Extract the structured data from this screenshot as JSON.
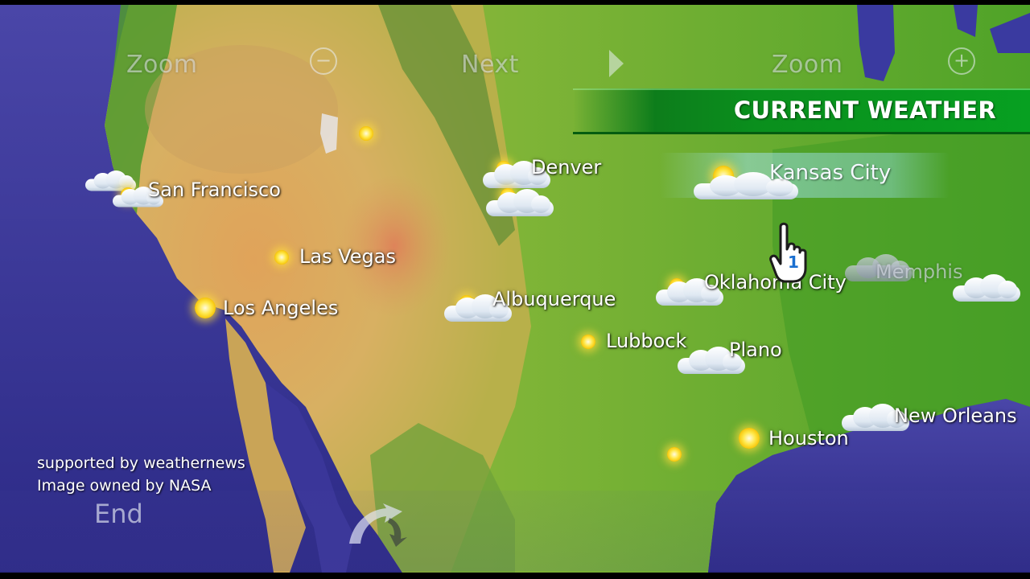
{
  "controls": {
    "zoom_out_label": "Zoom",
    "zoom_out_symbol": "−",
    "next_label": "Next",
    "zoom_in_label": "Zoom",
    "zoom_in_symbol": "+"
  },
  "banner": {
    "title": "CURRENT WEATHER"
  },
  "cities": [
    {
      "name": "San Francisco",
      "weather": "cloudy-sun"
    },
    {
      "name": "Denver",
      "weather": "cloudy-sun"
    },
    {
      "name": "Kansas City",
      "weather": "cloudy-sun"
    },
    {
      "name": "Las Vegas",
      "weather": "sunny"
    },
    {
      "name": "Los Angeles",
      "weather": "sunny"
    },
    {
      "name": "Albuquerque",
      "weather": "cloudy-sun"
    },
    {
      "name": "Oklahoma City",
      "weather": "cloudy-sun"
    },
    {
      "name": "Memphis",
      "weather": "cloudy"
    },
    {
      "name": "Lubbock",
      "weather": "sunny"
    },
    {
      "name": "Plano",
      "weather": "cloudy"
    },
    {
      "name": "New Orleans",
      "weather": "cloudy"
    },
    {
      "name": "Houston",
      "weather": "sunny"
    }
  ],
  "selected_city": "Kansas City",
  "credits": {
    "line1": "supported by weathernews",
    "line2": "Image owned by NASA"
  },
  "end_label": "End",
  "pointer": {
    "player_number": "1",
    "icon": "hand-pointer-icon"
  },
  "colors": {
    "ocean": "#3b3494",
    "banner_green": "#0a8f1d",
    "land_green": "#5fae2a",
    "desert": "#d4a24a"
  }
}
